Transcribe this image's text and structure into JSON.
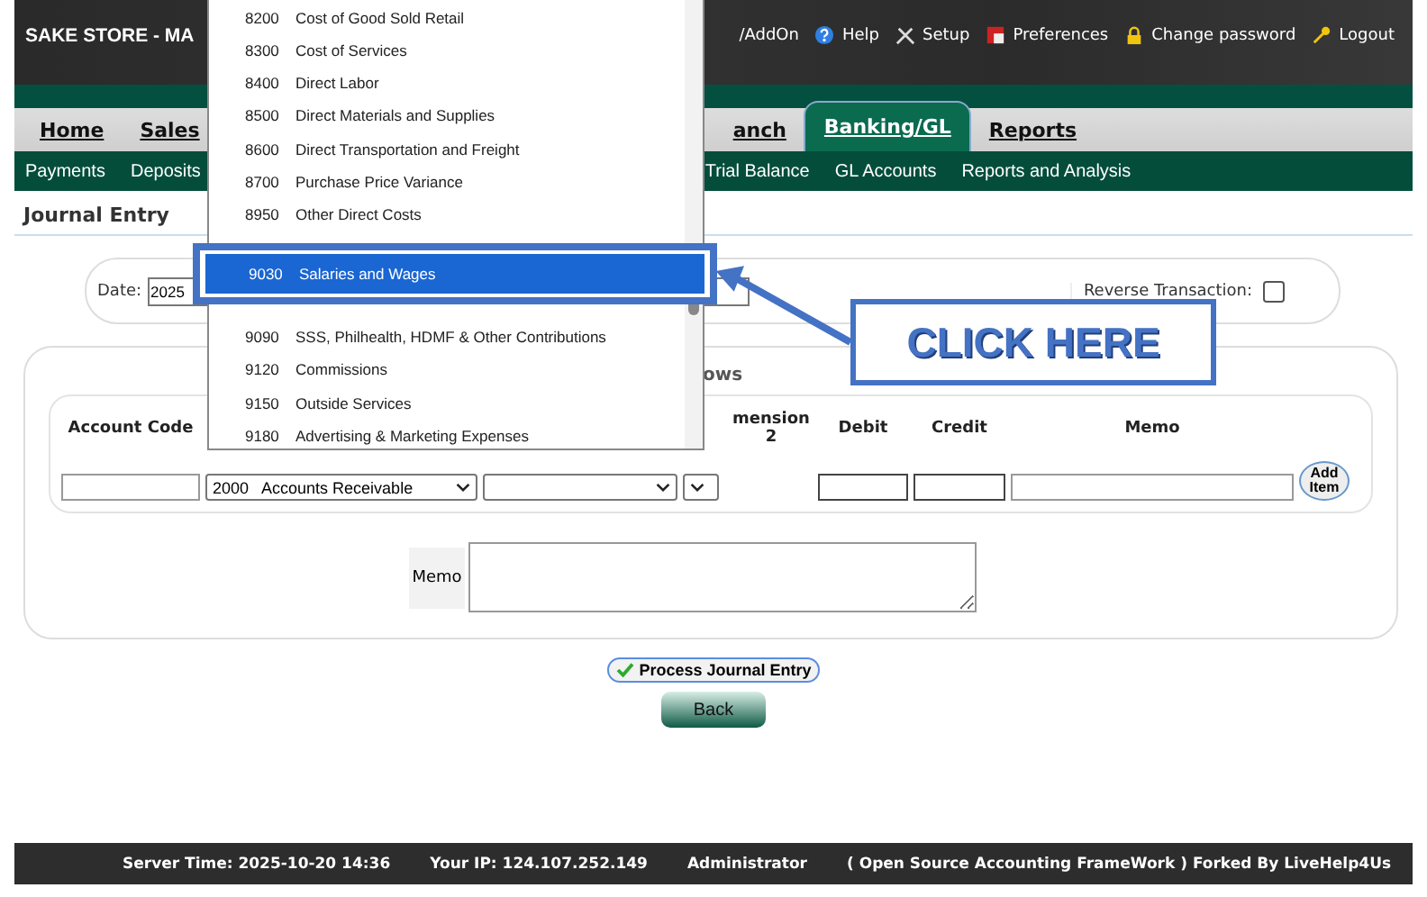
{
  "header": {
    "title": "SAKE STORE - MA",
    "links": [
      {
        "label": "/AddOn",
        "kind": "none"
      },
      {
        "label": "Help",
        "kind": "help"
      },
      {
        "label": "Setup",
        "kind": "setup"
      },
      {
        "label": "Preferences",
        "kind": "preferences"
      },
      {
        "label": "Change password",
        "kind": "password"
      },
      {
        "label": "Logout",
        "kind": "logout"
      }
    ]
  },
  "tabs": {
    "left": [
      {
        "label": "Home",
        "selected": false
      },
      {
        "label": "Sales",
        "selected": false
      }
    ],
    "right": [
      {
        "label": "anch",
        "selected": false
      },
      {
        "label": "Banking/GL",
        "selected": true
      },
      {
        "label": "Reports",
        "selected": false
      }
    ]
  },
  "subnav": {
    "left": [
      "Payments",
      "Deposits"
    ],
    "right": [
      "Trial Balance",
      "GL Accounts",
      "Reports and Analysis"
    ]
  },
  "page_title": "Journal Entry",
  "date_bar": {
    "label": "Date:",
    "value": "2025",
    "reverse_label": "Reverse Transaction:",
    "reverse_checked": false
  },
  "rows_panel": {
    "heading": "ows",
    "columns": [
      "Account Code",
      "",
      "",
      "mension 2",
      "Debit",
      "Credit",
      "Memo"
    ],
    "account_select": "2000   Accounts Receivable",
    "add_button": "Add Item"
  },
  "memo": {
    "label": "Memo"
  },
  "buttons": {
    "process": "Process Journal Entry",
    "back": "Back"
  },
  "footer": [
    "Server Time: 2025-10-20 14:36",
    "Your IP: 124.107.252.149",
    "Administrator",
    "( Open Source Accounting FrameWork ) Forked By LiveHelp4Us"
  ],
  "dropdown": {
    "before": [
      {
        "code": "8200",
        "name": "Cost of Good Sold Retail"
      },
      {
        "code": "8300",
        "name": "Cost of Services"
      },
      {
        "code": "8400",
        "name": "Direct Labor"
      },
      {
        "code": "8500",
        "name": "Direct Materials and Supplies"
      },
      {
        "code": "8600",
        "name": "Direct Transportation and Freight"
      },
      {
        "code": "8700",
        "name": "Purchase Price Variance"
      },
      {
        "code": "8950",
        "name": "Other Direct Costs"
      }
    ],
    "highlighted": {
      "code": "9030",
      "name": "Salaries and Wages",
      "selected": true
    },
    "after": [
      {
        "code": "9090",
        "name": "SSS, Philhealth, HDMF & Other Contributions"
      },
      {
        "code": "9120",
        "name": "Commissions"
      },
      {
        "code": "9150",
        "name": "Outside Services"
      },
      {
        "code": "9180",
        "name": "Advertising & Marketing Expenses"
      }
    ]
  },
  "callout": "CLICK HERE"
}
